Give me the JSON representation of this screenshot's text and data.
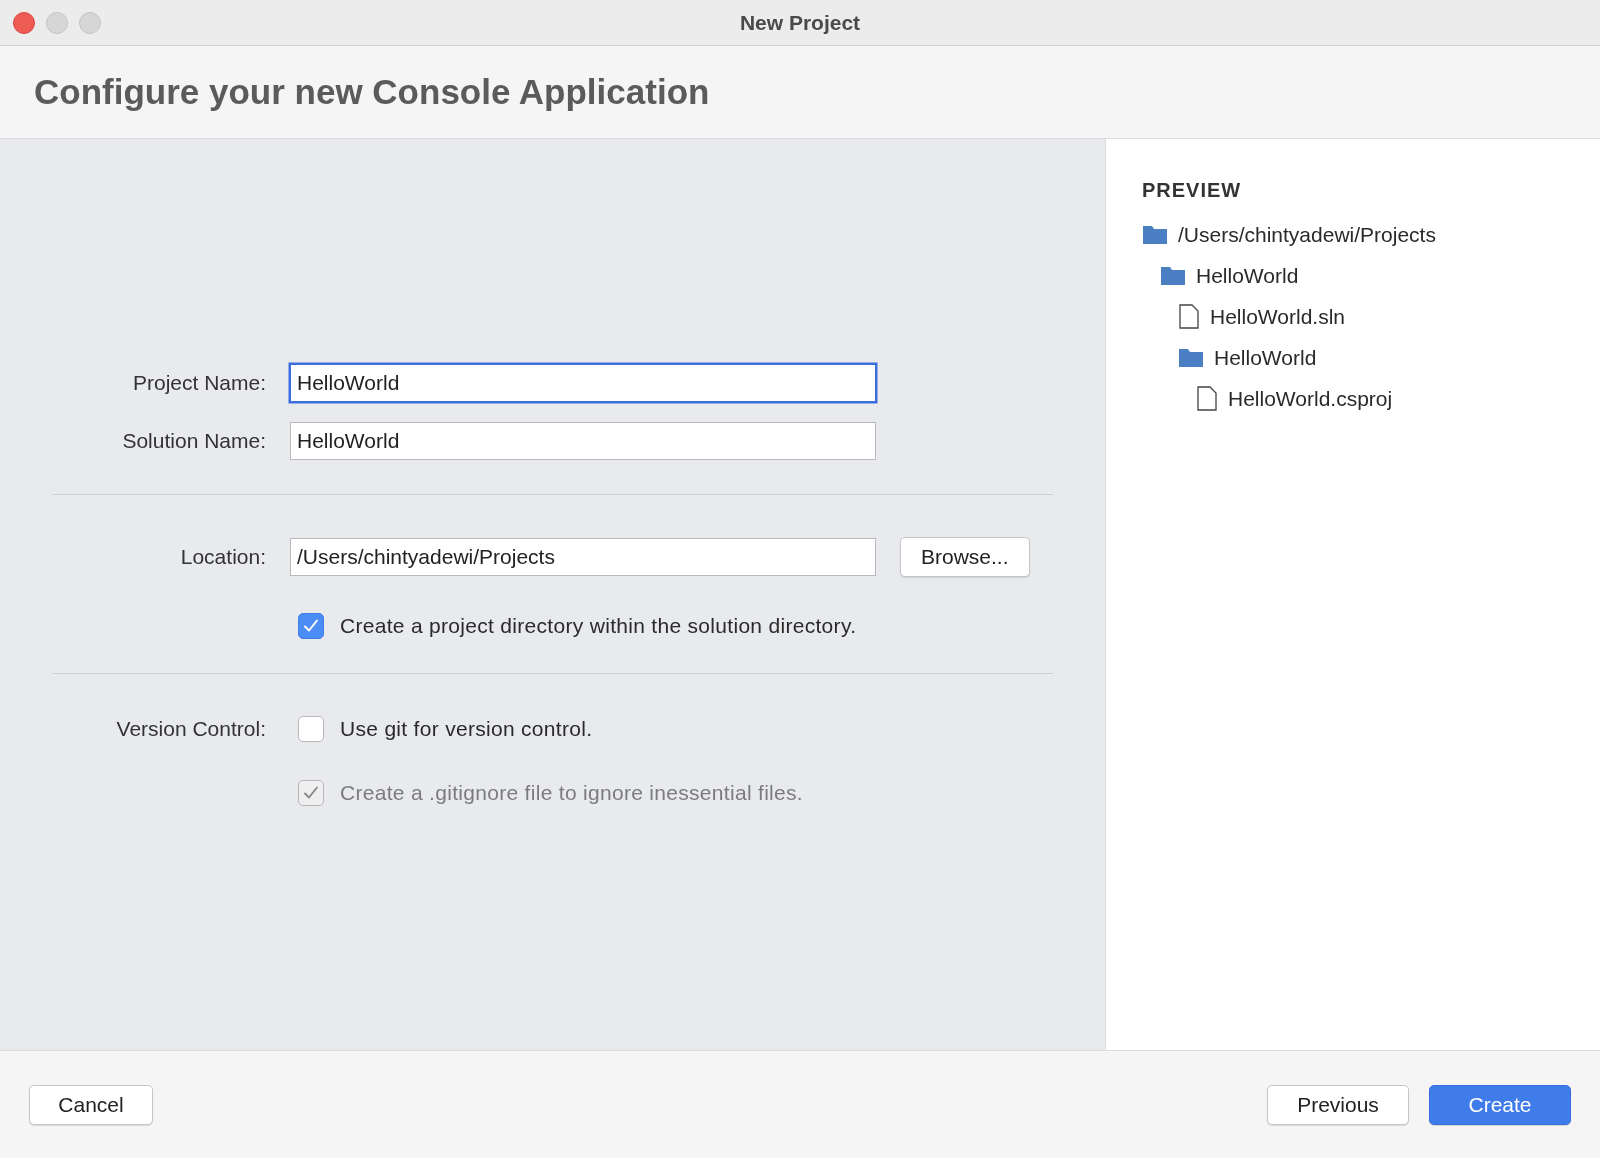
{
  "window": {
    "title": "New Project"
  },
  "header": {
    "title": "Configure your new Console Application"
  },
  "form": {
    "fields": [
      {
        "label": "Project Name:",
        "value": "HelloWorld",
        "focused": true
      },
      {
        "label": "Solution Name:",
        "value": "HelloWorld",
        "focused": false
      }
    ],
    "location": {
      "label": "Location:",
      "value": "/Users/chintyadewi/Projects",
      "focused": false,
      "button": "Browse..."
    },
    "project_directory": {
      "text": "Create a project directory within the solution directory.",
      "checked": true,
      "disabled": false
    },
    "version_control": {
      "label": "Version Control:",
      "options": [
        {
          "text": "Use git for version control.",
          "checked": false,
          "disabled": false
        },
        {
          "text": "Create a .gitignore file to ignore inessential files.",
          "checked": true,
          "disabled": true
        }
      ]
    }
  },
  "preview": {
    "title": "PREVIEW",
    "tree": [
      {
        "kind": "folder",
        "name": "/Users/chintyadewi/Projects",
        "children": [
          {
            "kind": "folder",
            "name": "HelloWorld",
            "children": [
              {
                "kind": "file",
                "name": "HelloWorld.sln"
              },
              {
                "kind": "folder",
                "name": "HelloWorld",
                "children": [
                  {
                    "kind": "file",
                    "name": "HelloWorld.csproj"
                  }
                ]
              }
            ]
          }
        ]
      }
    ]
  },
  "footer": {
    "left_buttons": [
      {
        "label": "Cancel"
      }
    ],
    "right_buttons": [
      {
        "label": "Previous",
        "kind": "default"
      },
      {
        "label": "Create",
        "kind": "primary"
      }
    ]
  }
}
